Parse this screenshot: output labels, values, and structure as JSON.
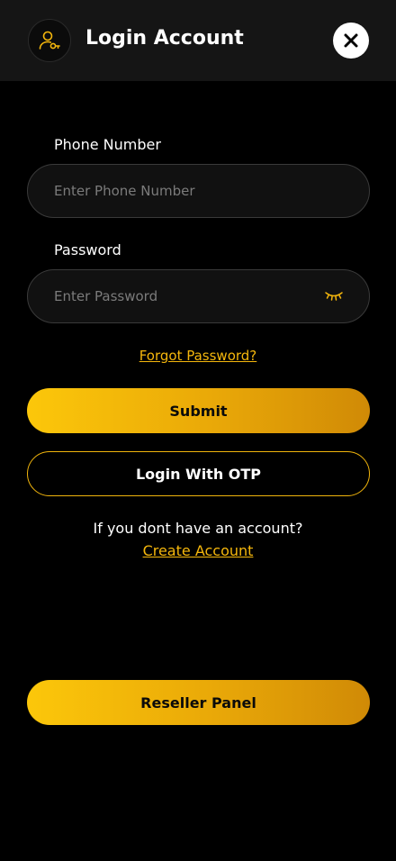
{
  "header": {
    "title": "Login Account",
    "avatar_icon": "user-key-icon",
    "close_icon": "close-icon"
  },
  "form": {
    "phone": {
      "label": "Phone Number",
      "placeholder": "Enter Phone Number",
      "value": ""
    },
    "password": {
      "label": "Password",
      "placeholder": "Enter Password",
      "value": "",
      "toggle_icon": "eye-closed-icon"
    },
    "forgot_password": "Forgot Password?",
    "submit_label": "Submit",
    "otp_label": "Login With OTP"
  },
  "signup": {
    "prompt": "If you dont have an account?",
    "link": "Create Account"
  },
  "reseller": {
    "label": "Reseller Panel"
  },
  "colors": {
    "accent": "#f5b70c",
    "gradient_start": "#fcc70a",
    "gradient_end": "#d08a06",
    "background": "#000000",
    "header_background": "#151515",
    "input_background": "#111111"
  }
}
